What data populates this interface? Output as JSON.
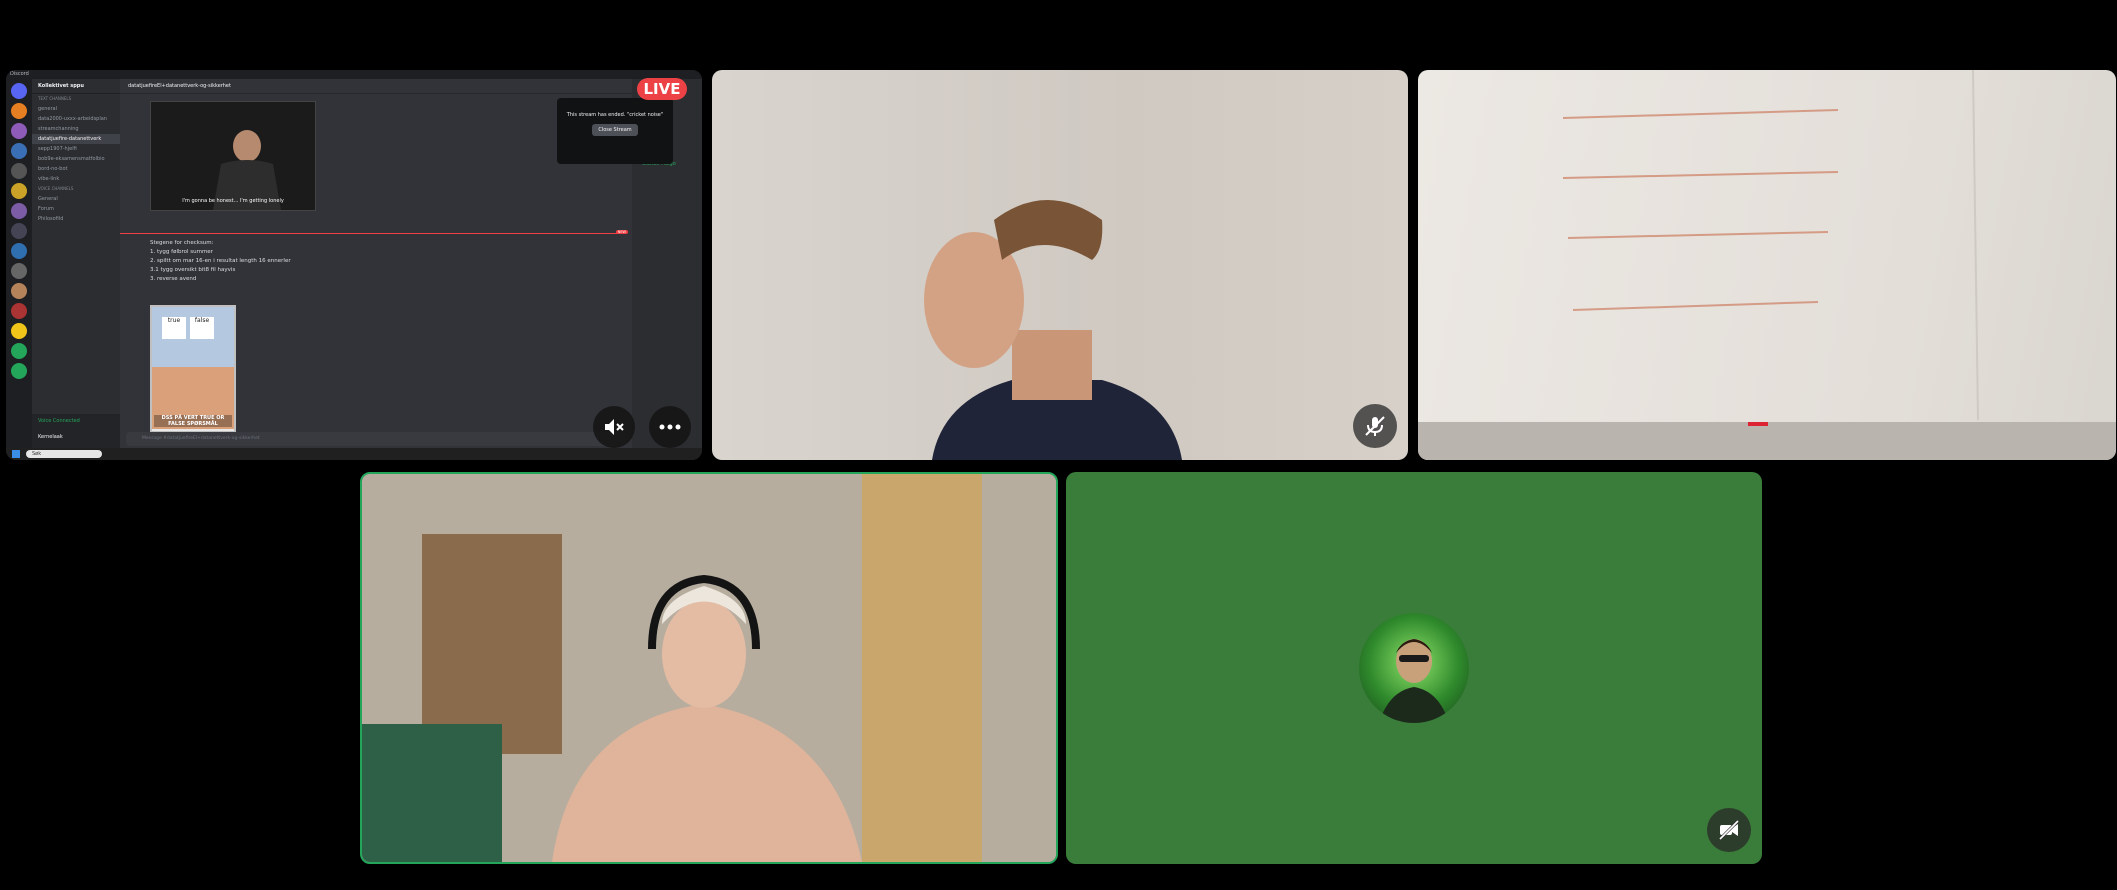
{
  "share": {
    "window_title": "Discord",
    "live_label": "LIVE",
    "server_name": "Kollektivet sppu",
    "channels": [
      {
        "label": "TEXT CHANNELS",
        "type": "header"
      },
      {
        "label": "general",
        "type": "text"
      },
      {
        "label": "data2000-uxxx-arbeidsplan",
        "type": "text"
      },
      {
        "label": "streamchanning",
        "type": "text"
      },
      {
        "label": "datatjuefire-datanettverk",
        "type": "active"
      },
      {
        "label": "sepp1907-hjelfi",
        "type": "text"
      },
      {
        "label": "bob9e-eksamensmatfolbio",
        "type": "text"
      },
      {
        "label": "bord-no-bot",
        "type": "text"
      },
      {
        "label": "vibe-link",
        "type": "text"
      },
      {
        "label": "VOICE CHANNELS",
        "type": "header"
      },
      {
        "label": "General",
        "type": "voice"
      },
      {
        "label": "Forum",
        "type": "text"
      },
      {
        "label": "Philosofild",
        "type": "text"
      }
    ],
    "chat_header": "datatjuefireEl+datanettverk-og-sikkerhet",
    "video_caption": "I'm gonna be honest... I'm getting lonely",
    "new_tag": "NEW",
    "steps": [
      "Stegene for checksum:",
      "1. tygg følbrol summer",
      "2. spiltt om mar 16-en i resultat length 16 ennerler",
      "3.1 tygg oversikt bit8 fil hayvis",
      "3. reverse avend"
    ],
    "meme": {
      "left": "true",
      "right": "false",
      "bottom": "DSS PÅ VERT TRUE OR FALSE SPØRSMÅL"
    },
    "message_placeholder": "Message #datatjuefireEl+datanettverk-og-sikkerhet",
    "members": [
      "Fåulf",
      "Gustav Hulgo"
    ],
    "toast_text": "This stream has ended. \"cricket noise\"",
    "toast_button": "Close Stream",
    "taskbar_search": "Søk",
    "user_panel": {
      "status": "Voice Connected",
      "name": "Kernelaak"
    }
  },
  "colors": {
    "live": "#ed4245",
    "speaking_border": "#23a55a",
    "avatar_bg": "#3a7d3a",
    "discord_bg": "#313338"
  },
  "controls": {
    "mute_icon": "speaker-muted-icon",
    "more_icon": "more-options-icon",
    "mic_off_icon": "microphone-off-icon",
    "camera_off_icon": "video-off-icon"
  }
}
